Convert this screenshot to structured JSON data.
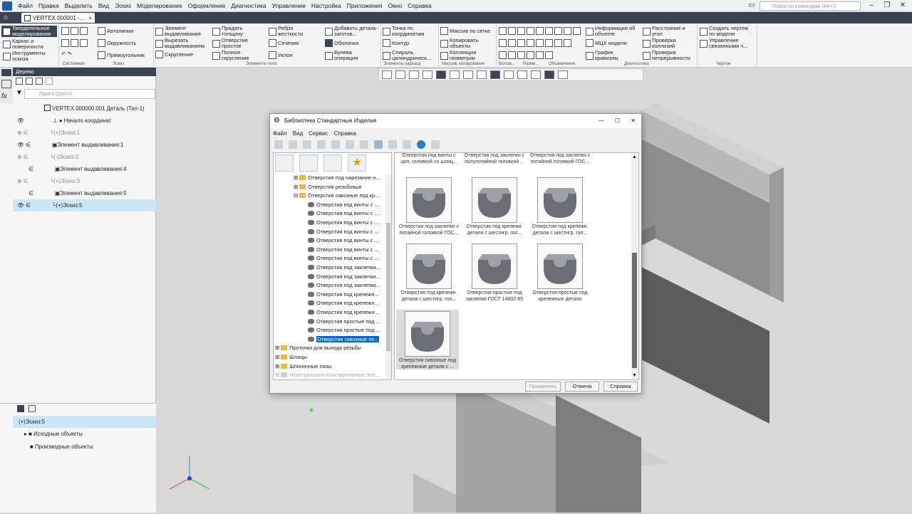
{
  "menu": [
    "Файл",
    "Правка",
    "Выделить",
    "Вид",
    "Эскиз",
    "Моделирование",
    "Оформление",
    "Диагностика",
    "Управление",
    "Настройка",
    "Приложения",
    "Окно",
    "Справка"
  ],
  "search_placeholder": "Поиск по командам (Alt+/)",
  "tab": {
    "doc": "VERTEX.000001 -...",
    "close": "×"
  },
  "ribbon": {
    "side": [
      "Твердотельное моделирование",
      "Каркас и поверхности",
      "Инструменты эскиза"
    ],
    "cells": [
      "Автолиния",
      "Окружность",
      "Прямоугольник",
      "Элемент выдавливания",
      "Вырезать выдавливанием",
      "Скругление",
      "Придать толщину",
      "Отверстие простое",
      "Полное скругление",
      "Ребро жесткости",
      "Сечение",
      "Уклон",
      "Добавить деталь-заготов...",
      "Оболочка",
      "Булева операция",
      "Точка по координатам",
      "Контур",
      "Спираль цилиндрическ...",
      "Массив по сетке",
      "Копировать объекты",
      "Коллекция геометрии",
      "Информация об объекте",
      "МЦХ модели",
      "График кривизны",
      "Расстояние и угол",
      "Проверка коллизий",
      "Проверка непрерывности",
      "Создать чертеж по модели",
      "Управление связанными ч..."
    ],
    "groups": [
      "Системная",
      "Эскиз",
      "Элементы тела",
      "Элементы каркаса",
      "Массив, копирование",
      "Вспом...",
      "Разме...",
      "Обозначения",
      "Диагностика",
      "Чертеж"
    ]
  },
  "tree": {
    "header": "Дерево",
    "search": "Поиск (Ctrl+/)",
    "root": "VERTEX.000000.001 Деталь (Тел-1)",
    "rows": [
      "Начало координат",
      "(+)Эскиз:1",
      "Элемент выдавливания:1",
      "(-)Эскиз:2",
      "Элемент выдавливания:4",
      "(+)Эскиз:3",
      "Элемент выдавливания:5",
      "(+)Эскиз:5"
    ]
  },
  "bottom": {
    "sel": "(+)Эскиз:5",
    "a": "Исходные объекты",
    "b": "Производные объекты"
  },
  "dialog": {
    "title": "Библиотека Стандартные Изделия",
    "menu": [
      "Файл",
      "Вид",
      "Сервис",
      "Справка"
    ],
    "nodes": [
      "Отверстия под нарезание н...",
      "Отверстия резьбовые",
      "Отверстия сквозные под кр...",
      "Отверстия под винты с ...",
      "Отверстия под винты с ...",
      "Отверстия под винты с ...",
      "Отверстия под винты с ...",
      "Отверстия под винты с ...",
      "Отверстия под винты с ...",
      "Отверстия под винты с ...",
      "Отверстия под заклепки...",
      "Отверстия под заклепки...",
      "Отверстия под заклепки...",
      "Отверстия под крепежн...",
      "Отверстия под крепежн...",
      "Отверстия под крепежн...",
      "Отверстия простые под ...",
      "Отверстия простые под ...",
      "Отверстия сквозные по...",
      "Проточки для выхода резьбы",
      "Шлицы",
      "Шпоночные пазы",
      "Неактуальные конструктивные эле..."
    ],
    "top_labels": [
      "Отверстия под винты с цил. головкой со шлиц...",
      "Отверстия под заклепки с полупотайной головкой ...",
      "Отверстия под заклепки с потайной головкой ГОС..."
    ],
    "items": [
      "Отверстия под заклепки с потайной головкой ГОС...",
      "Отверстия под крепежн. детали с шестигр. гол...",
      "Отверстия под крепежн. детали с шестигр. гол...",
      "Отверстия под крепежн. детали с шестигр. гол...",
      "Отверстия простые под заклепки ГОСТ 14802-85",
      "Отверстия простые под крепежные детали",
      "Отверстия сквозные под крепежные детали с ..."
    ],
    "buttons": {
      "apply": "Применить",
      "cancel": "Отмена",
      "help": "Справка"
    }
  }
}
